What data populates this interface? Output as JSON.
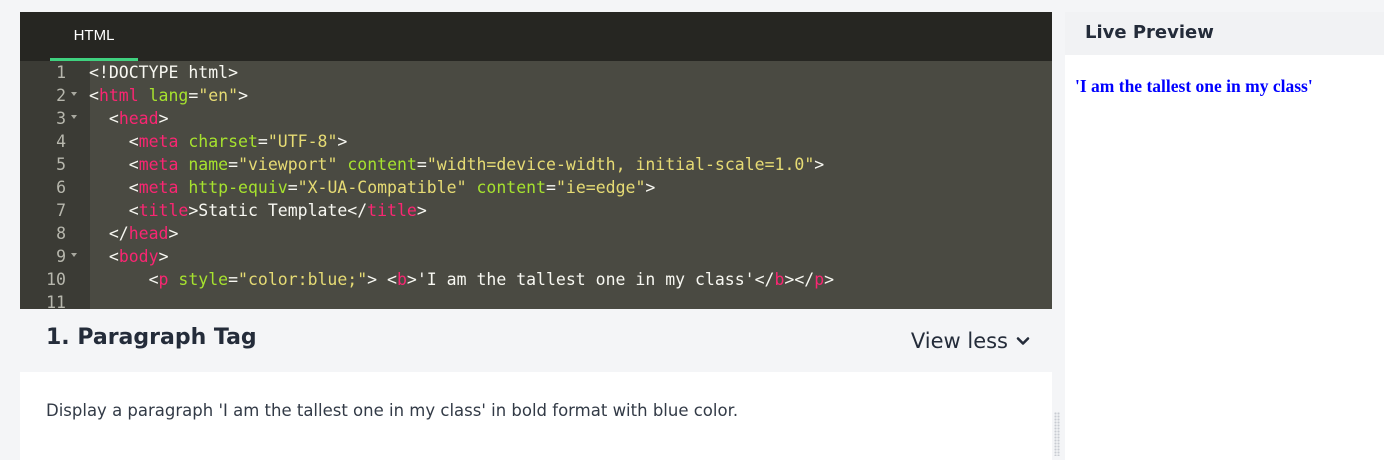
{
  "editor": {
    "tab_label": "HTML",
    "lines": [
      {
        "n": "1",
        "fold": false,
        "indent": 0,
        "tokens": [
          {
            "t": "pl",
            "v": "<!DOCTYPE html>"
          }
        ]
      },
      {
        "n": "2",
        "fold": true,
        "indent": 0,
        "tokens": [
          {
            "t": "pl",
            "v": "<"
          },
          {
            "t": "tag",
            "v": "html"
          },
          {
            "t": "pl",
            "v": " "
          },
          {
            "t": "attr",
            "v": "lang"
          },
          {
            "t": "pl",
            "v": "="
          },
          {
            "t": "str",
            "v": "\"en\""
          },
          {
            "t": "pl",
            "v": ">"
          }
        ]
      },
      {
        "n": "3",
        "fold": true,
        "indent": 1,
        "tokens": [
          {
            "t": "pl",
            "v": "<"
          },
          {
            "t": "tag",
            "v": "head"
          },
          {
            "t": "pl",
            "v": ">"
          }
        ]
      },
      {
        "n": "4",
        "fold": false,
        "indent": 2,
        "tokens": [
          {
            "t": "pl",
            "v": "<"
          },
          {
            "t": "tag",
            "v": "meta"
          },
          {
            "t": "pl",
            "v": " "
          },
          {
            "t": "attr",
            "v": "charset"
          },
          {
            "t": "pl",
            "v": "="
          },
          {
            "t": "str",
            "v": "\"UTF-8\""
          },
          {
            "t": "pl",
            "v": ">"
          }
        ]
      },
      {
        "n": "5",
        "fold": false,
        "indent": 2,
        "tokens": [
          {
            "t": "pl",
            "v": "<"
          },
          {
            "t": "tag",
            "v": "meta"
          },
          {
            "t": "pl",
            "v": " "
          },
          {
            "t": "attr",
            "v": "name"
          },
          {
            "t": "pl",
            "v": "="
          },
          {
            "t": "str",
            "v": "\"viewport\""
          },
          {
            "t": "pl",
            "v": " "
          },
          {
            "t": "attr",
            "v": "content"
          },
          {
            "t": "pl",
            "v": "="
          },
          {
            "t": "str",
            "v": "\"width=device-width, initial-scale=1.0\""
          },
          {
            "t": "pl",
            "v": ">"
          }
        ]
      },
      {
        "n": "6",
        "fold": false,
        "indent": 2,
        "tokens": [
          {
            "t": "pl",
            "v": "<"
          },
          {
            "t": "tag",
            "v": "meta"
          },
          {
            "t": "pl",
            "v": " "
          },
          {
            "t": "attr",
            "v": "http-equiv"
          },
          {
            "t": "pl",
            "v": "="
          },
          {
            "t": "str",
            "v": "\"X-UA-Compatible\""
          },
          {
            "t": "pl",
            "v": " "
          },
          {
            "t": "attr",
            "v": "content"
          },
          {
            "t": "pl",
            "v": "="
          },
          {
            "t": "str",
            "v": "\"ie=edge\""
          },
          {
            "t": "pl",
            "v": ">"
          }
        ]
      },
      {
        "n": "7",
        "fold": false,
        "indent": 2,
        "tokens": [
          {
            "t": "pl",
            "v": "<"
          },
          {
            "t": "tag",
            "v": "title"
          },
          {
            "t": "pl",
            "v": ">Static Template</"
          },
          {
            "t": "tag",
            "v": "title"
          },
          {
            "t": "pl",
            "v": ">"
          }
        ]
      },
      {
        "n": "8",
        "fold": false,
        "indent": 1,
        "tokens": [
          {
            "t": "pl",
            "v": "</"
          },
          {
            "t": "tag",
            "v": "head"
          },
          {
            "t": "pl",
            "v": ">"
          }
        ]
      },
      {
        "n": "9",
        "fold": true,
        "indent": 1,
        "tokens": [
          {
            "t": "pl",
            "v": "<"
          },
          {
            "t": "tag",
            "v": "body"
          },
          {
            "t": "pl",
            "v": ">"
          }
        ]
      },
      {
        "n": "10",
        "fold": false,
        "indent": 3,
        "tokens": [
          {
            "t": "pl",
            "v": "<"
          },
          {
            "t": "tag",
            "v": "p"
          },
          {
            "t": "pl",
            "v": " "
          },
          {
            "t": "attr",
            "v": "style"
          },
          {
            "t": "pl",
            "v": "="
          },
          {
            "t": "str",
            "v": "\"color:blue;\""
          },
          {
            "t": "pl",
            "v": "> <"
          },
          {
            "t": "tag",
            "v": "b"
          },
          {
            "t": "pl",
            "v": ">'I am the tallest one in my class'</"
          },
          {
            "t": "tag",
            "v": "b"
          },
          {
            "t": "pl",
            "v": "></"
          },
          {
            "t": "tag",
            "v": "p"
          },
          {
            "t": "pl",
            "v": ">"
          }
        ]
      },
      {
        "n": "11",
        "fold": false,
        "indent": 0,
        "tokens": []
      }
    ]
  },
  "section": {
    "title": "1. Paragraph Tag",
    "toggle_label": "View less",
    "description": "Display a paragraph 'I am the tallest one in my class' in bold format with blue color."
  },
  "preview": {
    "title": "Live Preview",
    "output_text": "'I am the tallest one in my class'"
  },
  "colors": {
    "tag": "#f92672",
    "attr": "#a6e22e",
    "string": "#e6db74",
    "plain": "#f8f8f2",
    "tab_underline": "#3fd17f",
    "preview_text": "#0000ff"
  },
  "icons": {
    "toggle": "chevron-down-icon",
    "fold": "fold-arrow-icon",
    "resize": "drag-handle-icon"
  }
}
